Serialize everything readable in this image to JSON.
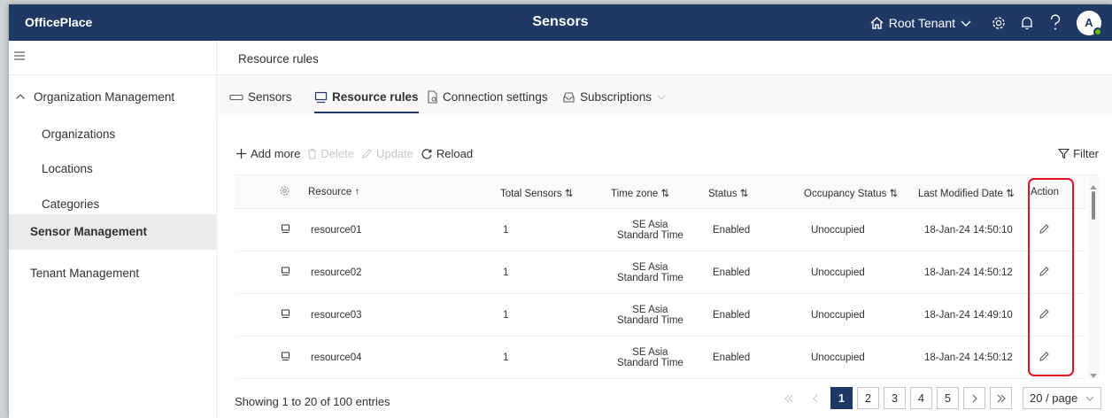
{
  "app": {
    "brand": "OfficePlace",
    "title": "Sensors",
    "tenant_label": "Root Tenant",
    "avatar_initial": "A"
  },
  "sidebar": {
    "group_label": "Organization Management",
    "sub_items": [
      "Organizations",
      "Locations",
      "Categories"
    ],
    "active_item": "Sensor Management",
    "other_item": "Tenant Management"
  },
  "breadcrumb": "Resource rules",
  "tabs": [
    {
      "label": "Sensors",
      "icon": "sensor-icon"
    },
    {
      "label": "Resource rules",
      "icon": "monitor-icon",
      "active": true
    },
    {
      "label": "Connection settings",
      "icon": "doc-settings-icon"
    },
    {
      "label": "Subscriptions",
      "icon": "inbox-icon"
    }
  ],
  "toolbar": {
    "add": "Add more",
    "delete": "Delete",
    "update": "Update",
    "reload": "Reload",
    "filter": "Filter"
  },
  "table": {
    "headers": {
      "resource": "Resource ↑",
      "total": "Total Sensors ⇅",
      "tz": "Time zone ⇅",
      "status": "Status ⇅",
      "occupancy": "Occupancy Status ⇅",
      "modified": "Last Modified Date ⇅",
      "action": "Action"
    },
    "rows": [
      {
        "resource": "resource01",
        "total": "1",
        "tz_line1": "SE Asia",
        "tz_line2": "Standard Time",
        "status": "Enabled",
        "occupancy": "Unoccupied",
        "modified": "18-Jan-24 14:50:10"
      },
      {
        "resource": "resource02",
        "total": "1",
        "tz_line1": "SE Asia",
        "tz_line2": "Standard Time",
        "status": "Enabled",
        "occupancy": "Unoccupied",
        "modified": "18-Jan-24 14:50:12"
      },
      {
        "resource": "resource03",
        "total": "1",
        "tz_line1": "SE Asia",
        "tz_line2": "Standard Time",
        "status": "Enabled",
        "occupancy": "Unoccupied",
        "modified": "18-Jan-24 14:49:10"
      },
      {
        "resource": "resource04",
        "total": "1",
        "tz_line1": "SE Asia",
        "tz_line2": "Standard Time",
        "status": "Enabled",
        "occupancy": "Unoccupied",
        "modified": "18-Jan-24 14:50:12"
      }
    ]
  },
  "footer": {
    "summary": "Showing 1 to 20 of 100 entries",
    "pages": [
      "1",
      "2",
      "3",
      "4",
      "5"
    ],
    "active_page": "1",
    "page_size": "20 / page"
  },
  "colors": {
    "header_bg": "#1f3864",
    "highlight": "#e81123",
    "active_nav_bg": "#edebe9"
  }
}
